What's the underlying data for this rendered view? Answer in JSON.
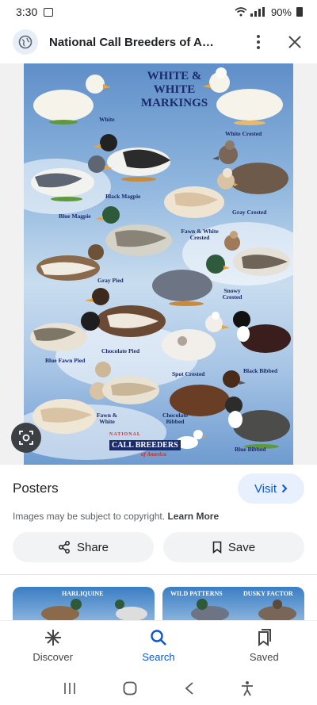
{
  "status": {
    "time": "3:30",
    "battery": "90%"
  },
  "browser": {
    "page_title": "National Call Breeders of Ame..."
  },
  "poster": {
    "title_line1": "WHITE &",
    "title_line2": "WHITE",
    "title_line3": "MARKINGS",
    "labels": {
      "white": "White",
      "white_crested": "White Crested",
      "black_magpie": "Black Magpie",
      "blue_magpie": "Blue Magpie",
      "gray_crested": "Gray Crested",
      "fawn_white_crested": "Fawn & White Crested",
      "gray_pied": "Gray Pied",
      "snowy_crested": "Snowy Crested",
      "chocolate_pied": "Chocolate Pied",
      "blue_fawn_pied": "Blue Fawn Pied",
      "spot_crested": "Spot Crested",
      "black_bibbed": "Black Bibbed",
      "fawn_white": "Fawn & White",
      "chocolate_bibbed": "Chocolate Bibbed",
      "blue_bibbed": "Blue Bibbed"
    },
    "brand_top": "NATIONAL",
    "brand_main": "CALL BREEDERS",
    "brand_sub": "of America"
  },
  "info": {
    "source": "Posters",
    "visit_label": "Visit",
    "copyright_text": "Images may be subject to copyright.",
    "learn_more": "Learn More"
  },
  "actions": {
    "share": "Share",
    "save": "Save"
  },
  "related": [
    {
      "label": "HARLIQUINE"
    },
    {
      "label": "WILD PATTERNS",
      "label2": "DUSKY FACTOR"
    }
  ],
  "nav": {
    "discover": "Discover",
    "search": "Search",
    "saved": "Saved"
  },
  "colors": {
    "accent": "#0b57d0",
    "visit_bg": "#e8f0fe",
    "poster_title": "#1b2a6b"
  },
  "icons": [
    "gallery-icon",
    "wifi-icon",
    "signal-icon",
    "battery-icon",
    "globe-icon",
    "more-vert-icon",
    "close-icon",
    "lens-icon",
    "chevron-right-icon",
    "share-icon",
    "bookmark-icon",
    "discover-icon",
    "search-icon",
    "saved-icon",
    "recents-icon",
    "home-icon",
    "back-icon",
    "accessibility-icon"
  ]
}
